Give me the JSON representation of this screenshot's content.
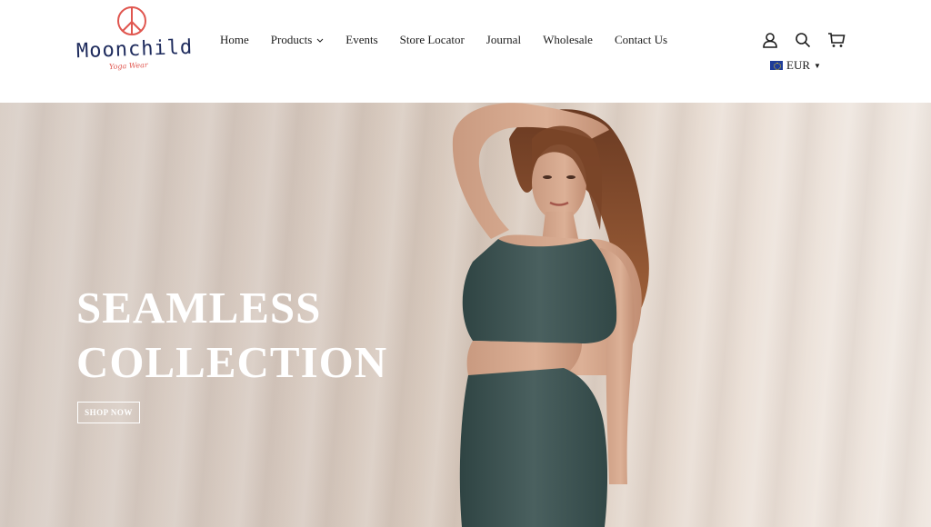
{
  "brand": {
    "name": "Moonchild",
    "tagline": "Yoga Wear"
  },
  "nav": {
    "items": [
      {
        "label": "Home",
        "has_dropdown": false
      },
      {
        "label": "Products",
        "has_dropdown": true
      },
      {
        "label": "Events",
        "has_dropdown": false
      },
      {
        "label": "Store Locator",
        "has_dropdown": false
      },
      {
        "label": "Journal",
        "has_dropdown": false
      },
      {
        "label": "Wholesale",
        "has_dropdown": false
      },
      {
        "label": "Contact Us",
        "has_dropdown": false
      }
    ]
  },
  "header_icons": [
    "account-icon",
    "search-icon",
    "cart-icon"
  ],
  "currency": {
    "code": "EUR",
    "flag": "eu-flag-icon"
  },
  "hero": {
    "title_line1": "SEAMLESS",
    "title_line2": "COLLECTION",
    "button_label": "SHOP NOW"
  },
  "colors": {
    "logo_blue": "#1d2a5c",
    "logo_red": "#e0564f",
    "hero_text": "#ffffff",
    "outfit": "#3f5655"
  }
}
